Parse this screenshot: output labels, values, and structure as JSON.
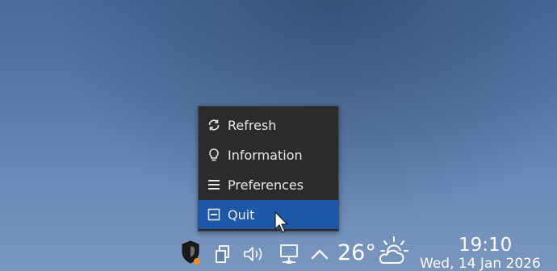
{
  "menu": {
    "items": [
      {
        "label": "Refresh",
        "icon": "refresh-icon"
      },
      {
        "label": "Information",
        "icon": "lightbulb-icon"
      },
      {
        "label": "Preferences",
        "icon": "hamburger-icon"
      },
      {
        "label": "Quit",
        "icon": "window-close-icon",
        "selected": true
      }
    ],
    "highlight_color": "#1c57a8"
  },
  "tray": {
    "icons": [
      "shield-icon",
      "clipboard-icon",
      "volume-icon",
      "network-icon",
      "chevron-up-icon",
      "weather-icon"
    ],
    "temperature": "26°",
    "alert_dot_color": "#f08c28"
  },
  "clock": {
    "time": "19:10",
    "date": "Wed, 14 Jan 2026"
  }
}
